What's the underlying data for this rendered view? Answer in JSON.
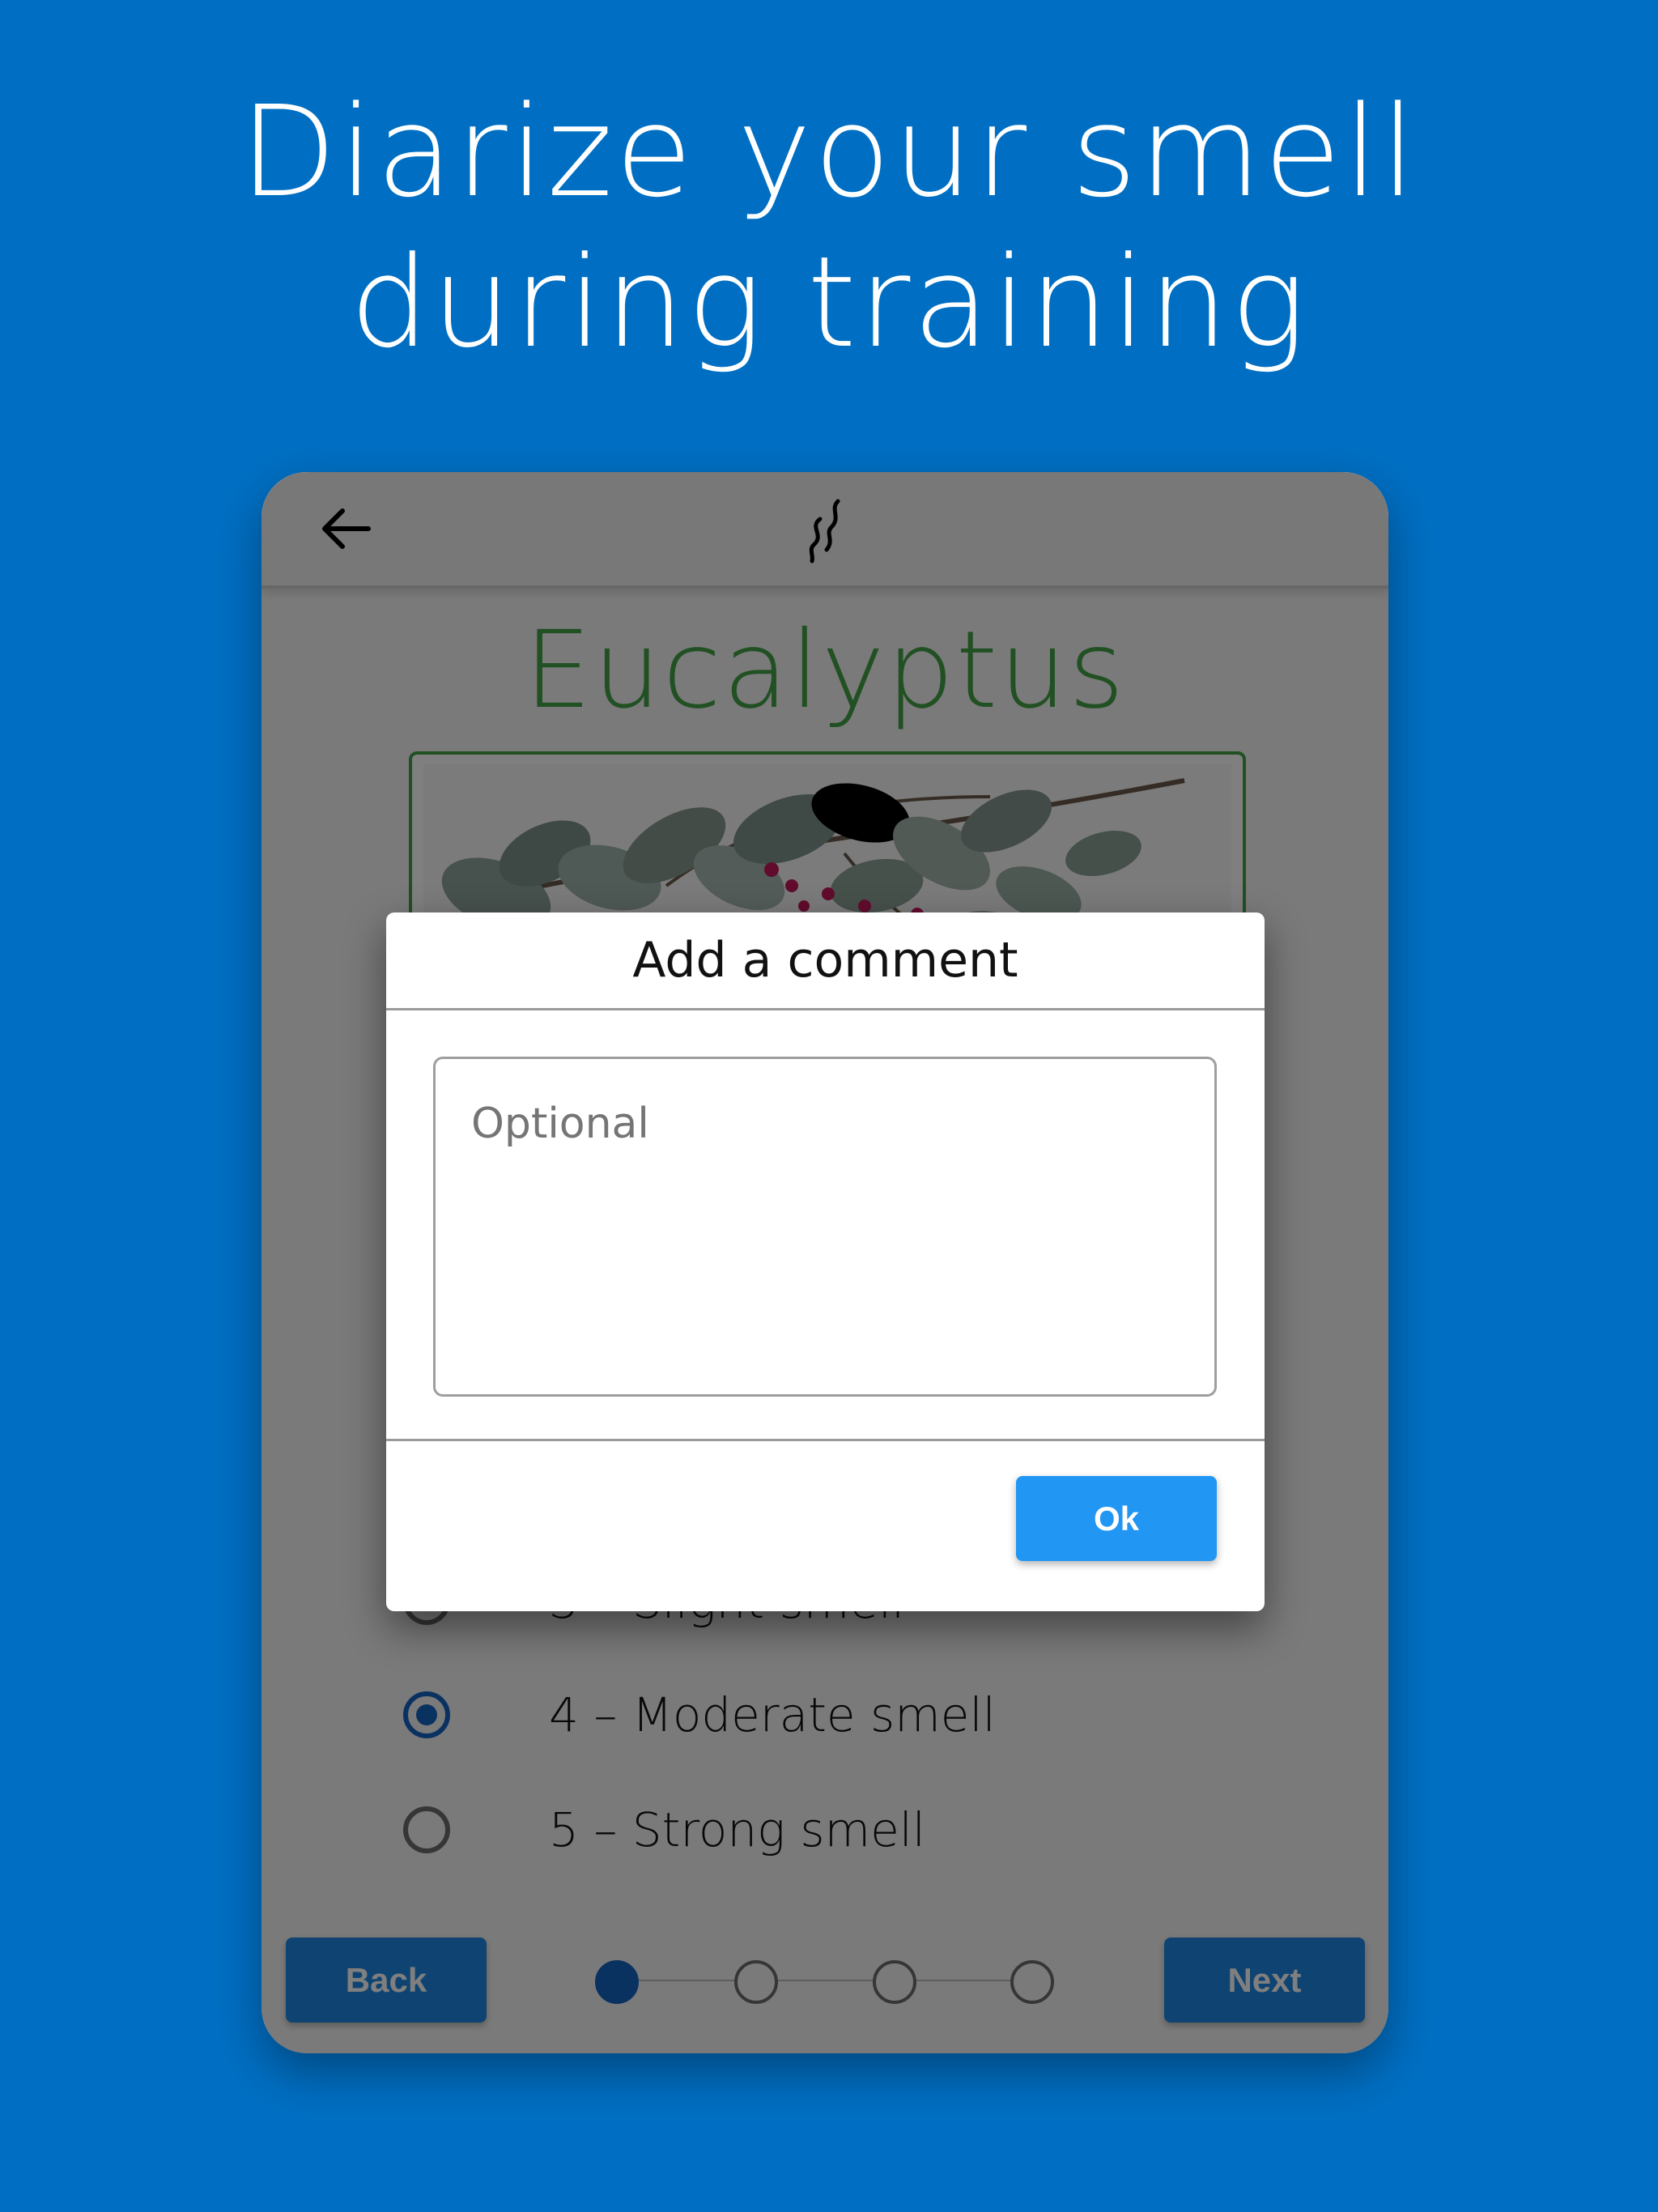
{
  "headline": {
    "line1": "Diarize your smell",
    "line2": "during training"
  },
  "app": {
    "plant_name": "Eucalyptus",
    "options": [
      {
        "label": "3 – Slight smell",
        "checked": false
      },
      {
        "label": "4 – Moderate smell",
        "checked": true
      },
      {
        "label": "5 – Strong smell",
        "checked": false
      }
    ],
    "back_label": "Back",
    "next_label": "Next",
    "stepper": {
      "current": 1,
      "total": 4
    }
  },
  "dialog": {
    "title": "Add a comment",
    "placeholder": "Optional",
    "ok_label": "Ok"
  },
  "icons": {
    "back": "arrow-left-icon",
    "logo": "smell-wave-logo"
  },
  "colors": {
    "background": "#006fc3",
    "accent_green": "#43a047",
    "primary_blue": "#1e88e5",
    "radio_checked": "#1565c0"
  }
}
